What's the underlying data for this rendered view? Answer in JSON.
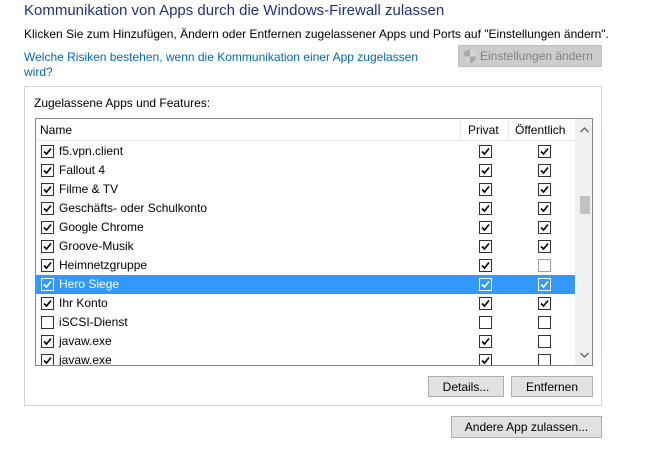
{
  "header": {
    "title": "Kommunikation von Apps durch die Windows-Firewall zulassen",
    "subtitle": "Klicken Sie zum Hinzufügen, Ändern oder Entfernen zugelassener Apps und Ports auf \"Einstellungen ändern\".",
    "risk_link": "Welche Risiken bestehen, wenn die Kommunikation einer App zugelassen wird?",
    "settings_button": "Einstellungen ändern"
  },
  "group": {
    "label": "Zugelassene Apps und Features:"
  },
  "table": {
    "columns": {
      "name": "Name",
      "private": "Privat",
      "public": "Öffentlich"
    },
    "rows": [
      {
        "name": "f5.vpn.client",
        "enabled": true,
        "private": true,
        "public": true,
        "selected": false
      },
      {
        "name": "Fallout 4",
        "enabled": true,
        "private": true,
        "public": true,
        "selected": false
      },
      {
        "name": "Filme & TV",
        "enabled": true,
        "private": true,
        "public": true,
        "selected": false
      },
      {
        "name": "Geschäfts- oder Schulkonto",
        "enabled": true,
        "private": true,
        "public": true,
        "selected": false
      },
      {
        "name": "Google Chrome",
        "enabled": true,
        "private": true,
        "public": true,
        "selected": false
      },
      {
        "name": "Groove-Musik",
        "enabled": true,
        "private": true,
        "public": true,
        "selected": false
      },
      {
        "name": "Heimnetzgruppe",
        "enabled": true,
        "private": true,
        "public": false,
        "selected": false
      },
      {
        "name": "Hero Siege",
        "enabled": true,
        "private": true,
        "public": true,
        "selected": true
      },
      {
        "name": "Ihr Konto",
        "enabled": true,
        "private": true,
        "public": true,
        "selected": false
      },
      {
        "name": "iSCSI-Dienst",
        "enabled": false,
        "private": false,
        "public": false,
        "selected": false
      },
      {
        "name": "javaw.exe",
        "enabled": true,
        "private": true,
        "public": false,
        "selected": false
      },
      {
        "name": "javaw.exe",
        "enabled": true,
        "private": true,
        "public": false,
        "selected": false
      }
    ]
  },
  "buttons": {
    "details": "Details...",
    "remove": "Entfernen",
    "add_app": "Andere App zulassen..."
  },
  "icons": {
    "settings": "uac-shield-icon",
    "scroll_up": "chevron-up-icon",
    "scroll_down": "chevron-down-icon"
  }
}
